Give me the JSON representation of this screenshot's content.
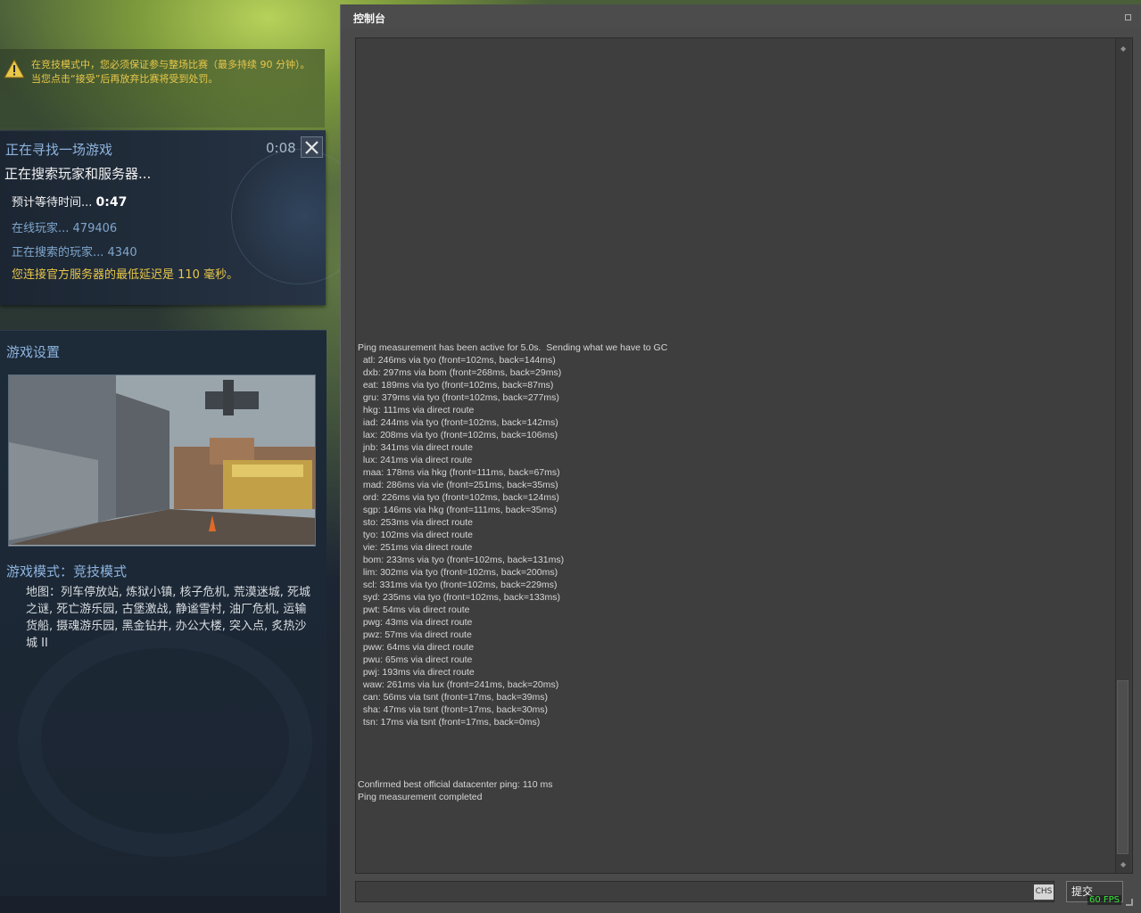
{
  "warning": {
    "text": "在竞技模式中，您必须保证参与整场比赛（最多持续 90 分钟）。当您点击“接受”后再放弃比赛将受到处罚。"
  },
  "search": {
    "title": "正在寻找一场游戏",
    "timer": "0:08",
    "status": "正在搜索玩家和服务器...",
    "wait_label": "预计等待时间... ",
    "wait_value": "0:47",
    "online": "在线玩家... 479406",
    "searching": "正在搜索的玩家... 4340",
    "latency": "您连接官方服务器的最低延迟是 110 毫秒。"
  },
  "settings": {
    "title": "游戏设置",
    "mode": "游戏模式：竞技模式",
    "maps": "地图：列车停放站, 炼狱小镇, 核子危机, 荒漠迷城, 死城之谜, 死亡游乐园, 古堡激战, 静谧雪村, 油厂危机, 运输货船, 摄魂游乐园, 黑金钻井, 办公大楼, 突入点, 炙热沙城 II"
  },
  "console": {
    "title": "控制台",
    "log": [
      "Ping measurement has been active for 5.0s.  Sending what we have to GC",
      "  atl: 246ms via tyo (front=102ms, back=144ms)",
      "  dxb: 297ms via bom (front=268ms, back=29ms)",
      "  eat: 189ms via tyo (front=102ms, back=87ms)",
      "  gru: 379ms via tyo (front=102ms, back=277ms)",
      "  hkg: 111ms via direct route",
      "  iad: 244ms via tyo (front=102ms, back=142ms)",
      "  lax: 208ms via tyo (front=102ms, back=106ms)",
      "  jnb: 341ms via direct route",
      "  lux: 241ms via direct route",
      "  maa: 178ms via hkg (front=111ms, back=67ms)",
      "  mad: 286ms via vie (front=251ms, back=35ms)",
      "  ord: 226ms via tyo (front=102ms, back=124ms)",
      "  sgp: 146ms via hkg (front=111ms, back=35ms)",
      "  sto: 253ms via direct route",
      "  tyo: 102ms via direct route",
      "  vie: 251ms via direct route",
      "  bom: 233ms via tyo (front=102ms, back=131ms)",
      "  lim: 302ms via tyo (front=102ms, back=200ms)",
      "  scl: 331ms via tyo (front=102ms, back=229ms)",
      "  syd: 235ms via tyo (front=102ms, back=133ms)",
      "  pwt: 54ms via direct route",
      "  pwg: 43ms via direct route",
      "  pwz: 57ms via direct route",
      "  pww: 64ms via direct route",
      "  pwu: 65ms via direct route",
      "  pwj: 193ms via direct route",
      "  waw: 261ms via lux (front=241ms, back=20ms)",
      "  can: 56ms via tsnt (front=17ms, back=39ms)",
      "  sha: 47ms via tsnt (front=17ms, back=30ms)",
      "  tsn: 17ms via tsnt (front=17ms, back=0ms)",
      "",
      "",
      "",
      "",
      "Confirmed best official datacenter ping: 110 ms",
      "Ping measurement completed"
    ],
    "input_value": "",
    "lang_badge": "CHS",
    "submit_label": "提交",
    "fps": "60 FPS"
  },
  "icons": {
    "warning": "warning-triangle-icon",
    "close": "close-icon",
    "maximize": "maximize-icon",
    "scroll_up": "scroll-up-icon",
    "scroll_down": "scroll-down-icon"
  },
  "colors": {
    "accent_blue": "#8db4de",
    "warning_yellow": "#e8c74a",
    "fps_green": "#37e23b"
  }
}
